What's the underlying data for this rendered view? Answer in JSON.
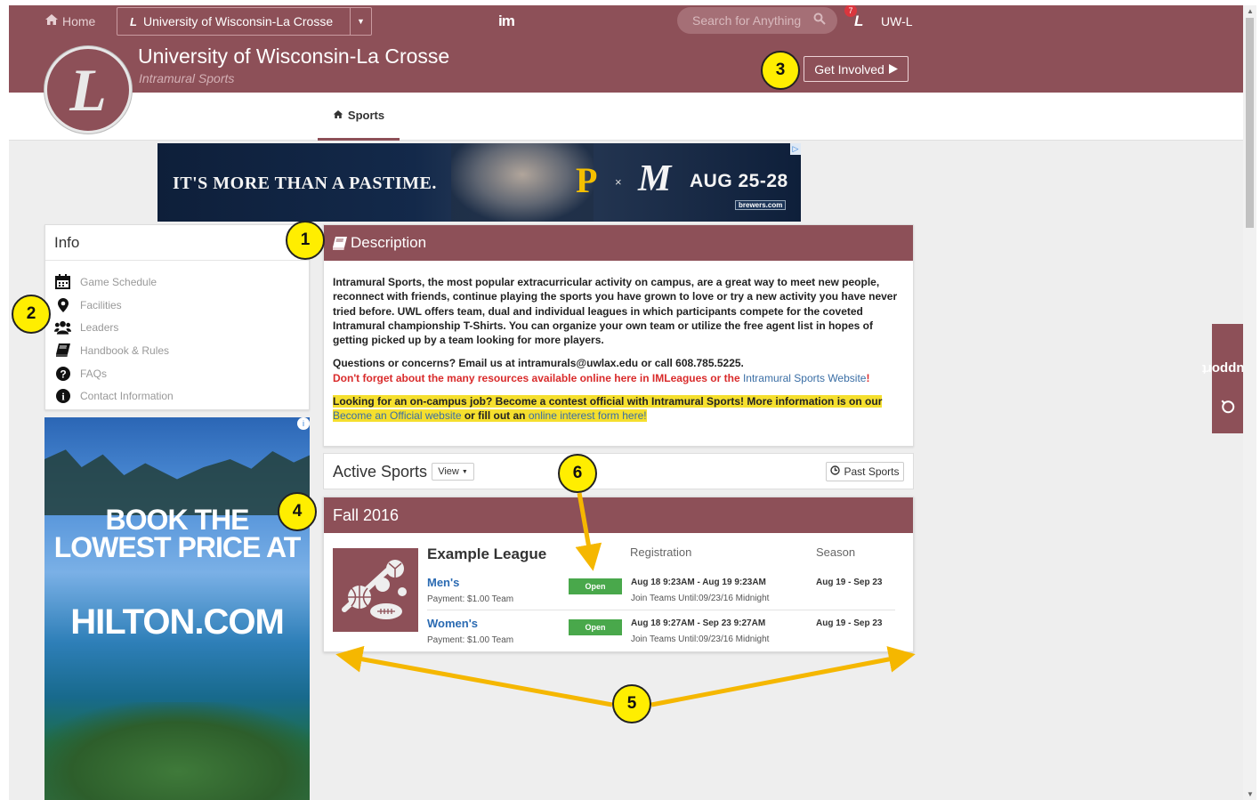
{
  "topnav": {
    "home_label": "Home",
    "school_name": "University of Wisconsin-La Crosse",
    "logo_text": "im",
    "search_placeholder": "Search for Anything",
    "notification_count": "7",
    "user_label": "UW-L"
  },
  "header": {
    "title": "University of Wisconsin-La Crosse",
    "subtitle": "Intramural Sports",
    "get_involved_label": "Get Involved"
  },
  "tabs": [
    {
      "label": "Sports",
      "icon": "home-icon"
    }
  ],
  "ad_top": {
    "headline": "IT'S MORE THAN A PASTIME.",
    "p_logo": "P",
    "vs": "×",
    "m_logo": "M",
    "dates": "AUG 25-28",
    "brand": "brewers.com"
  },
  "info": {
    "title": "Info",
    "items": [
      {
        "label": "Game Schedule",
        "icon": "calendar-icon"
      },
      {
        "label": "Facilities",
        "icon": "map-marker-icon"
      },
      {
        "label": "Leaders",
        "icon": "users-icon"
      },
      {
        "label": "Handbook & Rules",
        "icon": "book-icon"
      },
      {
        "label": "FAQs",
        "icon": "question-icon"
      },
      {
        "label": "Contact Information",
        "icon": "info-icon"
      }
    ]
  },
  "ad_side": {
    "line1": "BOOK THE LOWEST PRICE AT",
    "line2": "HILTON.COM"
  },
  "description": {
    "title": "Description",
    "para1": "Intramural Sports, the most popular extracurricular activity on campus, are a great way to meet new people, reconnect with friends, continue playing the sports you have grown to love or try a new activity you have never tried before.  UWL offers team, dual and individual leagues in which participants compete for the coveted Intramural championship T-Shirts.  You can organize your own team or utilize the free agent list in hopes of getting picked up by a team looking for more players.",
    "para2": "Questions or concerns? Email us at intramurals@uwlax.edu or call 608.785.5225.",
    "red_text": "Don't forget about the many resources available online here in IMLeagues or the ",
    "red_link": "Intramural Sports Website",
    "red_end": "!",
    "job_text": "Looking for an on-campus job? Become a contest official with Intramural Sports! More information is on our ",
    "job_link1": "Become an Official website",
    "job_mid": " or fill out an ",
    "job_link2": "online interest form here!"
  },
  "active_sports": {
    "title": "Active Sports",
    "view_label": "View",
    "past_label": "Past Sports"
  },
  "season": {
    "title": "Fall 2016",
    "league_name": "Example League",
    "col_registration": "Registration",
    "col_season": "Season",
    "divisions": [
      {
        "name": "Men's",
        "payment": "Payment: $1.00 Team",
        "status": "Open",
        "registration": "Aug 18 9:23AM - Aug 19 9:23AM",
        "join": "Join Teams Until:09/23/16 Midnight",
        "season": "Aug 19 - Sep 23"
      },
      {
        "name": "Women's",
        "payment": "Payment: $1.00 Team",
        "status": "Open",
        "registration": "Aug 18 9:27AM - Sep 23 9:27AM",
        "join": "Join Teams Until:09/23/16 Midnight",
        "season": "Aug 19 - Sep 23"
      }
    ]
  },
  "support_label": "Support",
  "callouts": [
    "1",
    "2",
    "3",
    "4",
    "5",
    "6"
  ],
  "colors": {
    "brand": "#8d5058",
    "callout": "#ffee00",
    "arrow": "#f5b700",
    "open": "#49a84b",
    "link": "#3a6ea5",
    "alert": "#d92b2b",
    "highlight": "#f5df2e"
  }
}
